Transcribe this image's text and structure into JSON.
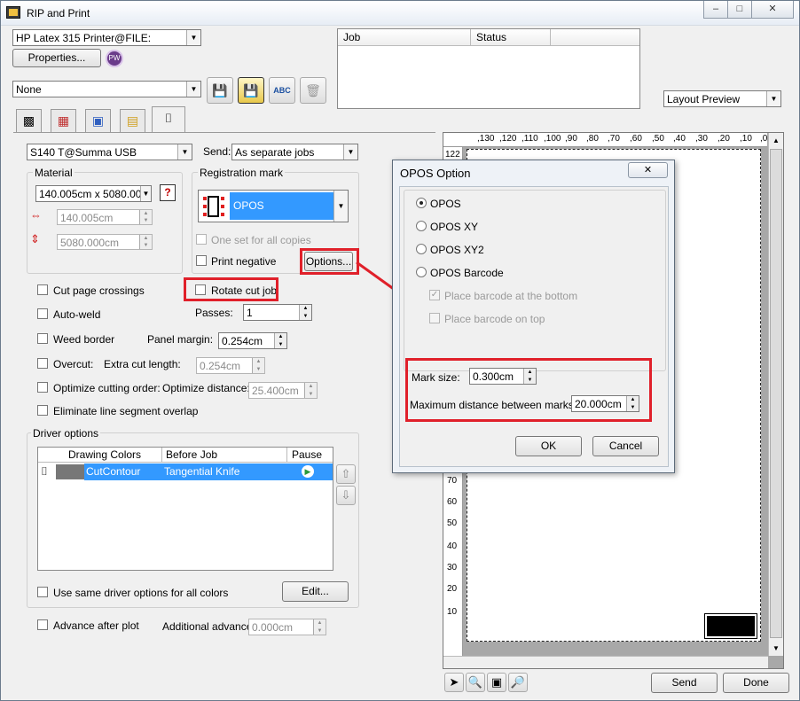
{
  "window": {
    "title": "RIP and Print",
    "controls": [
      "–",
      "□",
      "✕"
    ]
  },
  "top": {
    "printer": "HP Latex 315 Printer@FILE:",
    "properties_label": "Properties...",
    "preset": "None",
    "view_mode": "Layout Preview"
  },
  "jobs_table": {
    "columns": [
      "Job",
      "Status"
    ]
  },
  "cutter": {
    "device": "S140 T@Summa USB",
    "send_label": "Send:",
    "send_value": "As separate jobs",
    "material_title": "Material",
    "material_size": "140.005cm x 5080.000c",
    "width": "140.005cm",
    "height": "5080.000cm",
    "registration_title": "Registration mark",
    "registration_value": "OPOS",
    "one_set_label": "One set for all copies",
    "print_negative_label": "Print negative",
    "options_label": "Options...",
    "cut_page_crossings": "Cut page crossings",
    "rotate_cut_job": "Rotate cut job",
    "auto_weld": "Auto-weld",
    "passes_label": "Passes:",
    "passes_value": "1",
    "weed_border": "Weed border",
    "panel_margin_label": "Panel margin:",
    "panel_margin_value": "0.254cm",
    "overcut": "Overcut:",
    "extra_cut_label": "Extra cut length:",
    "extra_cut_value": "0.254cm",
    "optimize_order": "Optimize cutting order:",
    "optimize_distance_label": "Optimize distance:",
    "optimize_distance_value": "25.400cm",
    "eliminate_overlap": "Eliminate line segment overlap",
    "driver_title": "Driver options",
    "driver_columns": [
      "Drawing Colors",
      "Before Job",
      "Pause"
    ],
    "driver_row": {
      "color": "CutContour",
      "before_job": "Tangential Knife"
    },
    "same_driver_label": "Use same driver options for all colors",
    "edit_label": "Edit...",
    "advance_label": "Advance after plot",
    "additional_advance_label": "Additional advance:",
    "additional_advance_value": "0.000cm"
  },
  "preview": {
    "ruler_top": [
      ",130",
      ",120",
      ",110",
      ",100",
      ",90",
      ",80",
      ",70",
      ",60",
      ",50",
      ",40",
      ",30",
      ",20",
      ",10",
      ",0"
    ],
    "ruler_left": [
      "122",
      "70",
      "60",
      "50",
      "40",
      "30",
      "20",
      "10"
    ],
    "send_label": "Send",
    "done_label": "Done"
  },
  "opos_dialog": {
    "title": "OPOS Option",
    "options": [
      "OPOS",
      "OPOS XY",
      "OPOS XY2",
      "OPOS Barcode"
    ],
    "barcode_bottom": "Place barcode at the bottom",
    "barcode_top": "Place barcode on top",
    "mark_size_label": "Mark size:",
    "mark_size_value": "0.300cm",
    "max_distance_label": "Maximum distance between marks:",
    "max_distance_value": "20.000cm",
    "ok_label": "OK",
    "cancel_label": "Cancel"
  },
  "colors": {
    "highlight": "#3399ff",
    "annotation_red": "#e0202a"
  }
}
